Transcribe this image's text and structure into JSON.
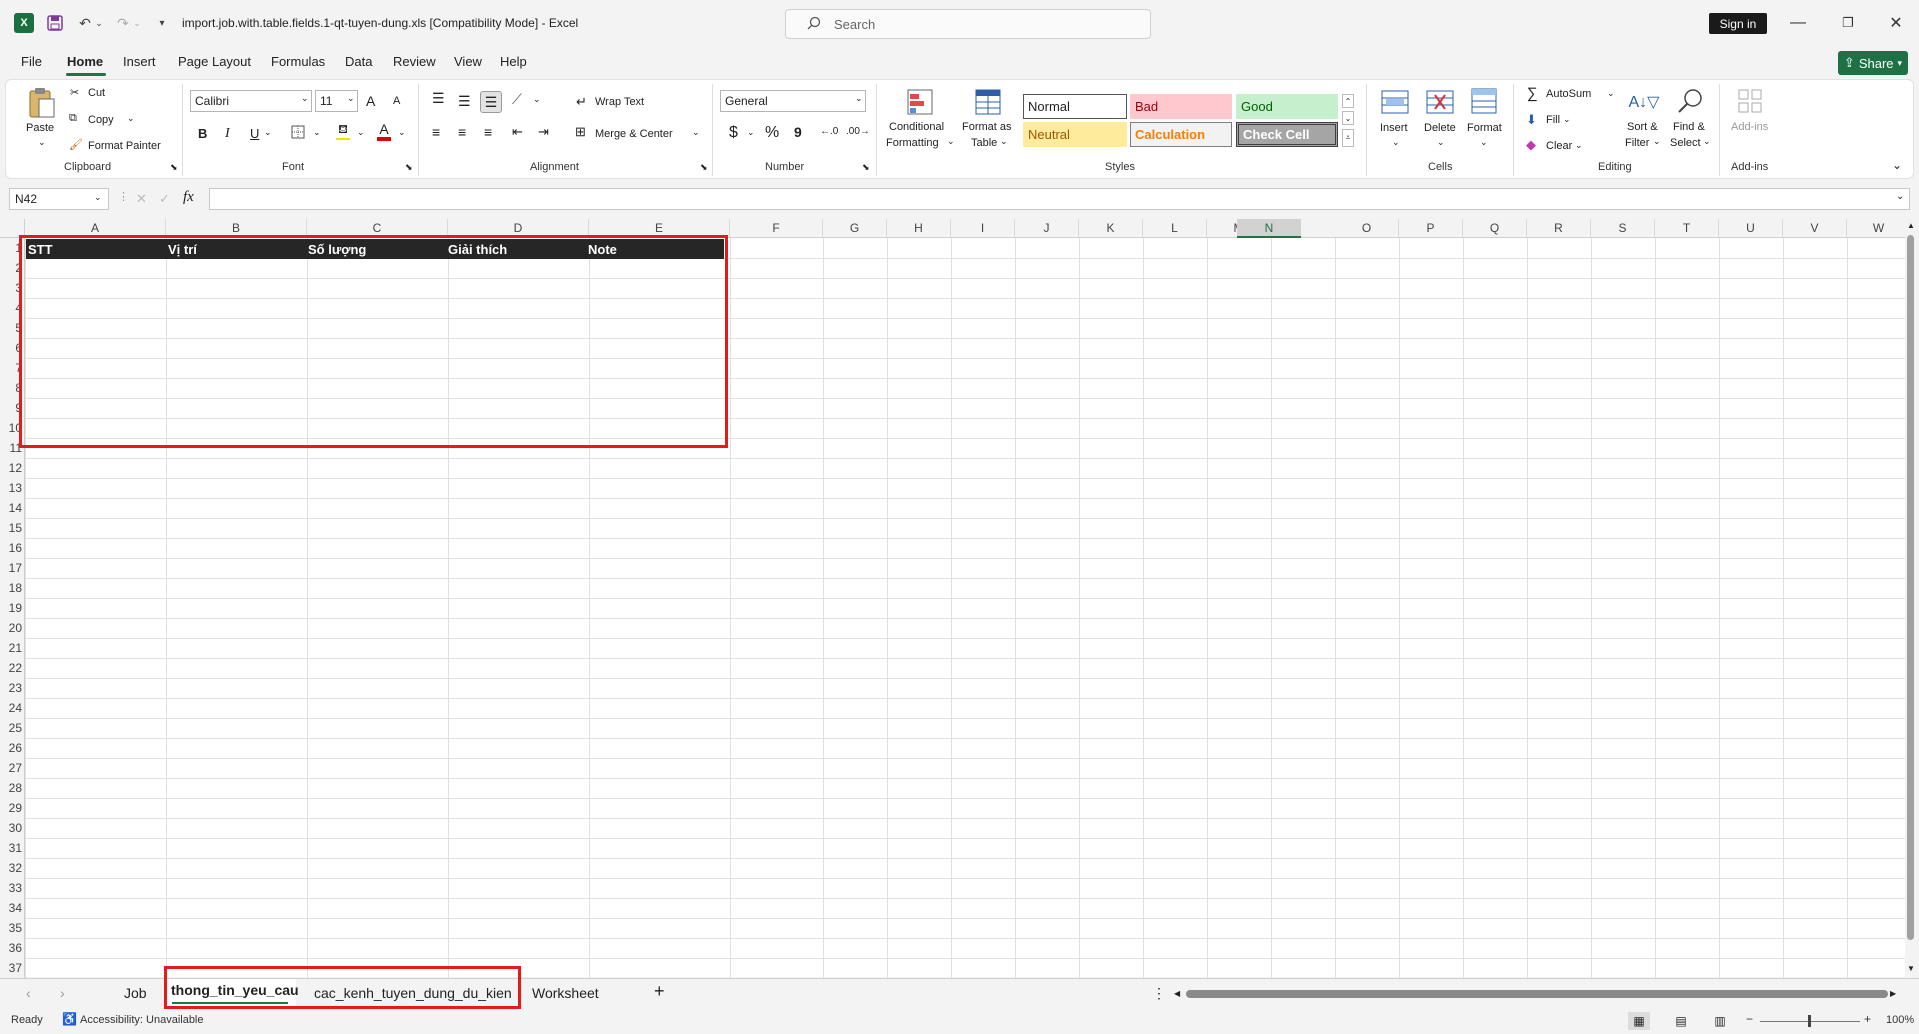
{
  "app": {
    "document_title": "import.job.with.table.fields.1-qt-tuyen-dung.xls  [Compatibility Mode]  -  Excel",
    "search_placeholder": "Search",
    "sign_in": "Sign in",
    "share": "Share"
  },
  "menu": [
    "File",
    "Home",
    "Insert",
    "Page Layout",
    "Formulas",
    "Data",
    "Review",
    "View",
    "Help"
  ],
  "ribbon": {
    "clipboard": {
      "paste": "Paste",
      "cut": "Cut",
      "copy": "Copy",
      "format_painter": "Format Painter",
      "label": "Clipboard"
    },
    "font": {
      "name": "Calibri",
      "size": "11",
      "label": "Font",
      "bold": "B",
      "italic": "I",
      "underline": "U",
      "grow": "A",
      "shrink": "A",
      "font_color": "A"
    },
    "alignment": {
      "wrap_text": "Wrap Text",
      "merge_center": "Merge & Center",
      "label": "Alignment"
    },
    "number": {
      "format": "General",
      "currency": "$",
      "percent": "%",
      "comma": "9",
      "label": "Number"
    },
    "styles": {
      "conditional_formatting_1": "Conditional",
      "conditional_formatting_2": "Formatting",
      "format_as_table_1": "Format as",
      "format_as_table_2": "Table",
      "normal": "Normal",
      "bad": "Bad",
      "good": "Good",
      "neutral": "Neutral",
      "calculation": "Calculation",
      "check_cell": "Check Cell",
      "label": "Styles"
    },
    "cells": {
      "insert": "Insert",
      "delete": "Delete",
      "format": "Format",
      "label": "Cells"
    },
    "editing": {
      "autosum": "AutoSum",
      "fill": "Fill",
      "clear": "Clear",
      "sort_filter_1": "Sort &",
      "sort_filter_2": "Filter",
      "find_select_1": "Find &",
      "find_select_2": "Select",
      "label": "Editing"
    },
    "addins": {
      "addins": "Add-ins",
      "label": "Add-ins"
    }
  },
  "formula_bar": {
    "name_box": "N42",
    "fx": "fx",
    "value": ""
  },
  "columns": [
    "A",
    "B",
    "C",
    "D",
    "E",
    "F",
    "G",
    "H",
    "I",
    "J",
    "K",
    "L",
    "M",
    "N",
    "O",
    "P",
    "Q",
    "R",
    "S",
    "T",
    "U",
    "V",
    "W"
  ],
  "rows": [
    "1",
    "2",
    "3",
    "4",
    "5",
    "6",
    "7",
    "8",
    "9",
    "10",
    "11",
    "12",
    "13",
    "14",
    "15",
    "16",
    "17",
    "18",
    "19",
    "20",
    "21",
    "22",
    "23",
    "24",
    "25",
    "26",
    "27",
    "28",
    "29",
    "30",
    "31",
    "32",
    "33",
    "34",
    "35",
    "36",
    "37"
  ],
  "table_headers": [
    "STT",
    "Vị trí",
    "Số lượng",
    "Giải thích",
    "Note"
  ],
  "sheet_tabs": [
    "Job",
    "thong_tin_yeu_cau",
    "cac_kenh_tuyen_dung_du_kien",
    "Worksheet"
  ],
  "active_sheet": "thong_tin_yeu_cau",
  "status": {
    "ready": "Ready",
    "accessibility": "Accessibility: Unavailable",
    "zoom": "100%"
  },
  "colors": {
    "accent": "#217346",
    "header_fill": "#262626",
    "highlight_box": "#e41b1b"
  }
}
